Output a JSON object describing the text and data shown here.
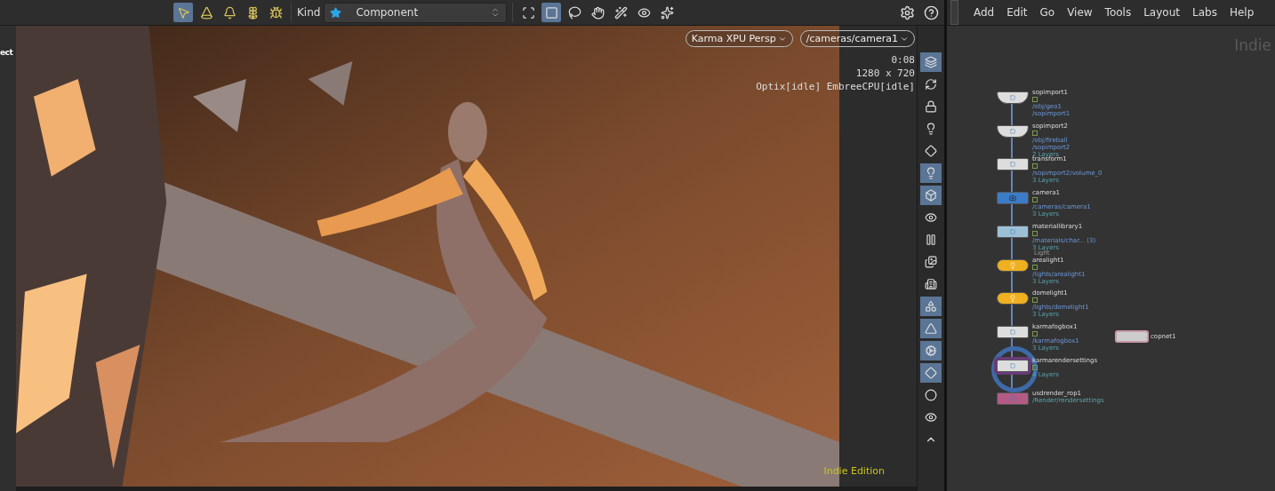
{
  "toolbar": {
    "tools": [
      {
        "selected": true
      },
      {
        "selected": false
      },
      {
        "selected": false
      },
      {
        "selected": false
      },
      {
        "selected": false
      }
    ],
    "kind_label": "Kind",
    "kind_value": "Component",
    "select_tools": [
      {
        "selected": false
      },
      {
        "selected": true
      },
      {
        "selected": false
      },
      {
        "selected": false
      },
      {
        "selected": false
      },
      {
        "selected": false
      },
      {
        "selected": false
      }
    ]
  },
  "viewport": {
    "side_label": "ect",
    "renderer": "Karma XPU  Persp",
    "camera": "/cameras/camera1",
    "info": [
      "0:08",
      "1280 x 720",
      "Optix[idle] EmbreeCPU[idle]"
    ],
    "edition": "Indie Edition"
  },
  "viewport_tools": [
    {
      "selected": true
    },
    {
      "selected": false
    },
    {
      "selected": false
    },
    {
      "selected": false
    },
    {
      "selected": false
    },
    {
      "selected": true
    },
    {
      "selected": true
    },
    {
      "selected": false
    },
    {
      "selected": false
    },
    {
      "selected": false
    },
    {
      "selected": false
    },
    {
      "selected": true
    },
    {
      "selected": true
    },
    {
      "selected": true
    },
    {
      "selected": true
    },
    {
      "selected": false
    },
    {
      "selected": false
    },
    {
      "selected": false
    }
  ],
  "network": {
    "menu": [
      "Add",
      "Edit",
      "Go",
      "View",
      "Tools",
      "Layout",
      "Labs",
      "Help"
    ],
    "watermark": "Indie",
    "nodes": [
      {
        "kind": "sop",
        "name": "sopimport1",
        "selected": false,
        "lines": [
          "/obj/geo1",
          "/sopimport1"
        ]
      },
      {
        "kind": "sop",
        "name": "sopimport2",
        "selected": false,
        "lines": [
          "/obj/fireball",
          "/sopimport2",
          "2 Layers"
        ]
      },
      {
        "kind": "xform",
        "name": "transform1",
        "selected": false,
        "lines": [
          "/sopimport2/volume_0",
          "3 Layers"
        ]
      },
      {
        "kind": "camera",
        "name": "camera1",
        "selected": false,
        "lines": [
          "/cameras/camera1",
          "3 Layers"
        ]
      },
      {
        "kind": "matlib",
        "name": "materiallibrary1",
        "selected": false,
        "lines": [
          "/materials/char... (3)",
          "3 Layers"
        ]
      },
      {
        "kind": "light",
        "name": "arealight1",
        "selected": false,
        "hint": "Light",
        "lines": [
          "/lights/arealight1",
          "3 Layers"
        ]
      },
      {
        "kind": "light",
        "name": "domelight1",
        "selected": false,
        "lines": [
          "/lights/domelight1",
          "3 Layers"
        ]
      },
      {
        "kind": "fog",
        "name": "karmafogbox1",
        "selected": false,
        "lines": [
          "/karmafogbox1",
          "3 Layers"
        ]
      },
      {
        "kind": "settings",
        "name": "karmarendersettings",
        "selected": true,
        "lines": [
          "4 Layers"
        ]
      },
      {
        "kind": "rop",
        "name": "usdrender_rop1",
        "selected": false,
        "lines": [
          "/Render/rendersettings"
        ]
      }
    ],
    "extra_node": {
      "name": "copnet1"
    }
  }
}
